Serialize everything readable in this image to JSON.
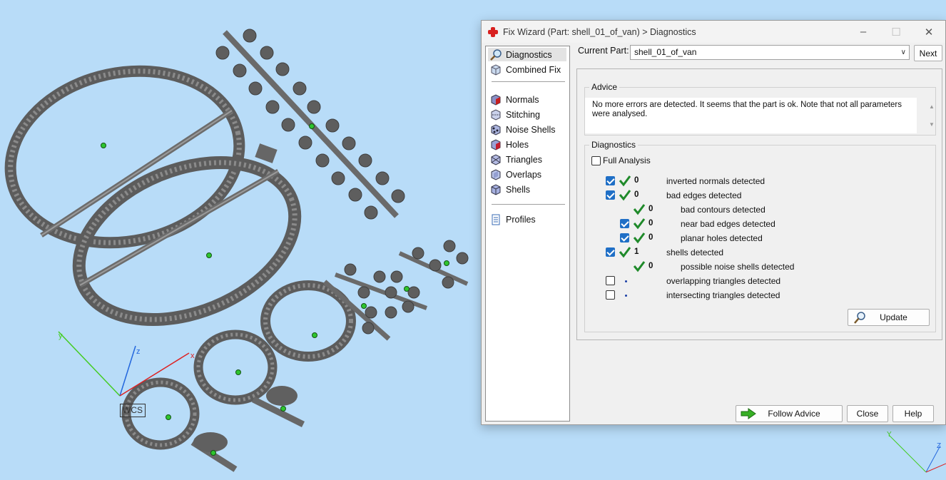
{
  "viewport": {
    "wcs_label": "WCS",
    "axis_x": "x",
    "axis_z": "z",
    "corner_axis_y": "Y",
    "corner_axis_z": "Z"
  },
  "window": {
    "title": "Fix Wizard (Part: shell_01_of_van) > Diagnostics"
  },
  "nav": {
    "items": [
      {
        "label": "Diagnostics",
        "icon": "magnifier-icon"
      },
      {
        "label": "Combined Fix",
        "icon": "cube-icon"
      },
      {
        "label": "Normals",
        "icon": "normals-cube-icon"
      },
      {
        "label": "Stitching",
        "icon": "stitching-cube-icon"
      },
      {
        "label": "Noise Shells",
        "icon": "noise-shells-icon"
      },
      {
        "label": "Holes",
        "icon": "holes-cube-icon"
      },
      {
        "label": "Triangles",
        "icon": "triangles-icon"
      },
      {
        "label": "Overlaps",
        "icon": "overlaps-cube-icon"
      },
      {
        "label": "Shells",
        "icon": "shells-cube-icon"
      },
      {
        "label": "Profiles",
        "icon": "document-icon"
      }
    ]
  },
  "current_part": {
    "label": "Current Part:",
    "value": "shell_01_of_van",
    "next_label": "Next"
  },
  "advice": {
    "legend": "Advice",
    "text": "No more errors are detected. It seems that the part is ok. Note that not all parameters were analysed."
  },
  "diagnostics": {
    "legend": "Diagnostics",
    "full_analysis_label": "Full Analysis",
    "rows": [
      {
        "count": "0",
        "label": "inverted normals detected"
      },
      {
        "count": "0",
        "label": "bad edges detected"
      },
      {
        "count": "0",
        "label": "bad contours detected"
      },
      {
        "count": "0",
        "label": "near bad edges detected"
      },
      {
        "count": "0",
        "label": "planar holes detected"
      },
      {
        "count": "1",
        "label": "shells detected"
      },
      {
        "count": "0",
        "label": "possible noise shells detected"
      },
      {
        "count": "",
        "label": "overlapping triangles detected"
      },
      {
        "count": "",
        "label": "intersecting triangles detected"
      }
    ],
    "update_label": "Update"
  },
  "footer": {
    "follow_advice_label": "Follow Advice",
    "close_label": "Close",
    "help_label": "Help"
  },
  "colors": {
    "viewport_bg": "#b8dcf8",
    "model_gray": "#6e6e6e",
    "checkbox_blue": "#1f6fc6",
    "tick_green": "#1f8a2a"
  }
}
